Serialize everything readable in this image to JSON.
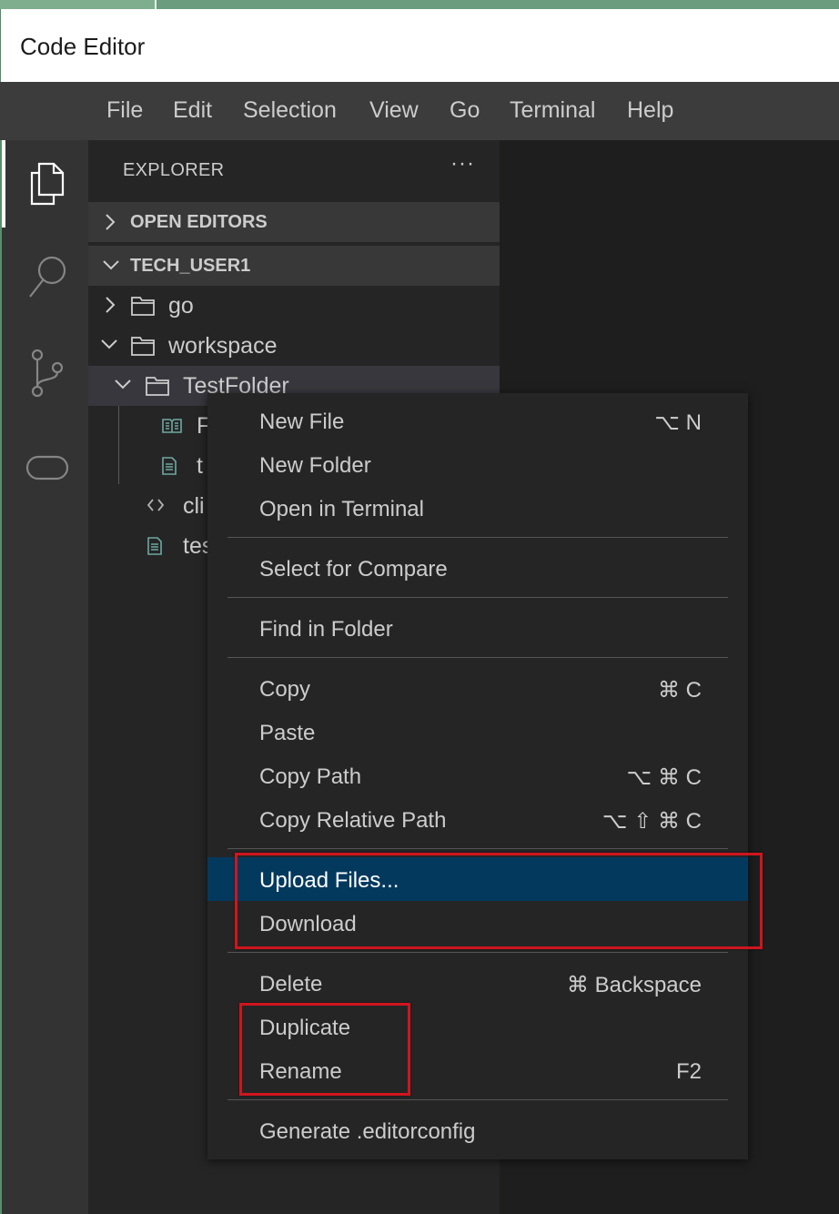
{
  "window": {
    "title": "Code Editor"
  },
  "menubar": {
    "items": [
      "File",
      "Edit",
      "Selection",
      "View",
      "Go",
      "Terminal",
      "Help"
    ]
  },
  "activity_bar": {
    "icons": [
      "files-icon",
      "search-icon",
      "source-control-icon",
      "remote-icon"
    ]
  },
  "sidebar": {
    "header": "EXPLORER",
    "more_glyph": "···",
    "sections": {
      "open_editors": "OPEN EDITORS",
      "workspace_root": "TECH_USER1"
    },
    "tree": [
      {
        "name": "go",
        "type": "folder",
        "expanded": false
      },
      {
        "name": "workspace",
        "type": "folder",
        "expanded": true
      },
      {
        "name": "TestFolder",
        "type": "folder",
        "expanded": true,
        "selected": true
      },
      {
        "name": "F",
        "type": "file",
        "icon": "book-icon"
      },
      {
        "name": "t",
        "type": "file",
        "icon": "file-icon"
      },
      {
        "name": "cli",
        "type": "file",
        "icon": "code-icon"
      },
      {
        "name": "tes",
        "type": "file",
        "icon": "file-icon"
      }
    ]
  },
  "context_menu": {
    "groups": [
      [
        {
          "label": "New File",
          "shortcut": "⌥ N"
        },
        {
          "label": "New Folder",
          "shortcut": ""
        },
        {
          "label": "Open in Terminal",
          "shortcut": ""
        }
      ],
      [
        {
          "label": "Select for Compare",
          "shortcut": ""
        }
      ],
      [
        {
          "label": "Find in Folder",
          "shortcut": ""
        }
      ],
      [
        {
          "label": "Copy",
          "shortcut": "⌘ C"
        },
        {
          "label": "Paste",
          "shortcut": ""
        },
        {
          "label": "Copy Path",
          "shortcut": "⌥ ⌘ C"
        },
        {
          "label": "Copy Relative Path",
          "shortcut": "⌥ ⇧ ⌘ C"
        }
      ],
      [
        {
          "label": "Upload Files...",
          "shortcut": "",
          "active": true
        },
        {
          "label": "Download",
          "shortcut": ""
        }
      ],
      [
        {
          "label": "Delete",
          "shortcut": "⌘ Backspace"
        },
        {
          "label": "Duplicate",
          "shortcut": ""
        },
        {
          "label": "Rename",
          "shortcut": "F2"
        }
      ],
      [
        {
          "label": "Generate .editorconfig",
          "shortcut": ""
        }
      ]
    ]
  },
  "annotations": {
    "highlight_color": "#d0151d"
  },
  "colors": {
    "menu_active": "#04395e",
    "sidebar_bg": "#252526",
    "activity_bg": "#333333"
  }
}
